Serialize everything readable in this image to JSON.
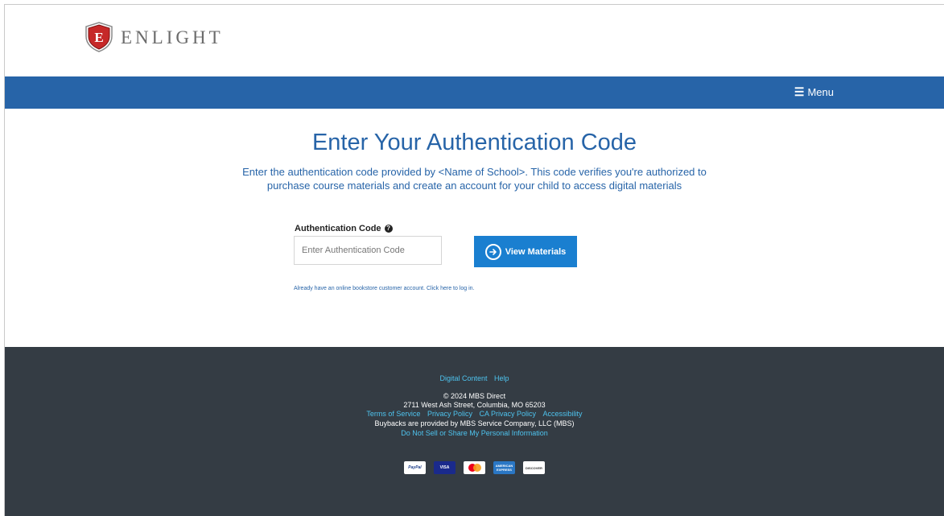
{
  "header": {
    "logo_letter": "E",
    "logo_text": "ENLIGHT"
  },
  "nav": {
    "menu_label": "Menu"
  },
  "main": {
    "title": "Enter Your Authentication Code",
    "subtitle_line1": "Enter the authentication code provided by <Name of School>. This code verifies you're authorized to",
    "subtitle_line2": "purchase course materials and create an account for your child to access digital materials",
    "auth_label": "Authentication Code",
    "auth_placeholder": "Enter Authentication Code",
    "auth_value": "",
    "view_button_label": "View Materials",
    "login_link": "Already have an online bookstore customer account. Click here to log in."
  },
  "footer": {
    "links_top": [
      "Digital Content",
      "Help"
    ],
    "copyright": "© 2024 MBS Direct",
    "address": "2711 West Ash Street, Columbia, MO 65203",
    "legal_links": [
      "Terms of Service",
      "Privacy Policy",
      "CA Privacy Policy",
      "Accessibility"
    ],
    "buybacks": "Buybacks are provided by MBS Service Company, LLC (MBS)",
    "do_not_sell": "Do Not Sell or Share My Personal Information",
    "cards": [
      "PayPal",
      "VISA",
      "MasterCard",
      "AMERICAN EXPRESS",
      "DISCOVER"
    ]
  },
  "colors": {
    "brand_blue": "#2764a8",
    "button_blue": "#1a7fd0",
    "footer_bg": "#343c44",
    "footer_link": "#4ec3ee",
    "logo_red": "#c62828"
  }
}
